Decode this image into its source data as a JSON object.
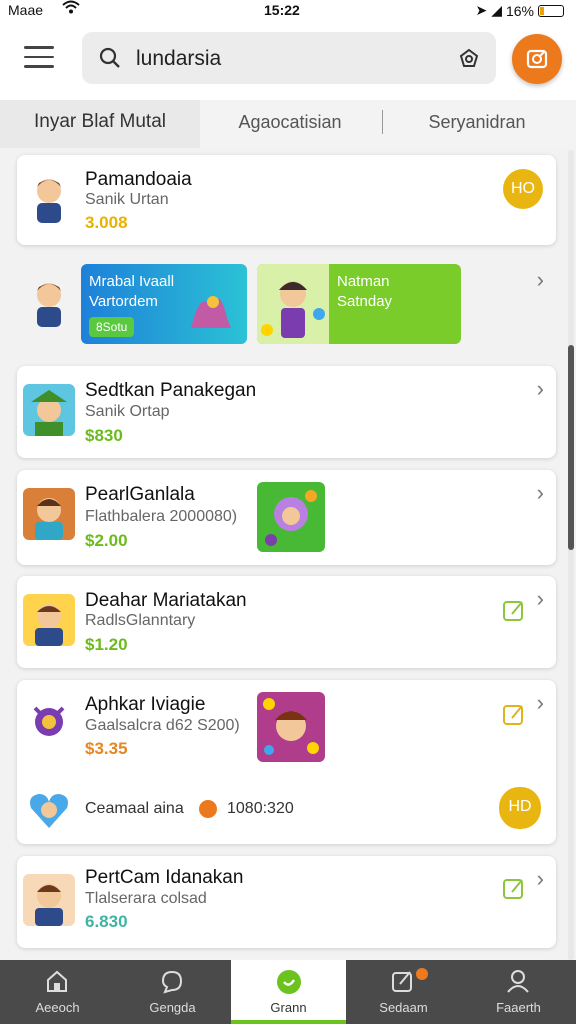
{
  "status": {
    "carrier": "Maae",
    "time": "15:22",
    "battery": "16%",
    "battery_level": 0.16
  },
  "search": {
    "query": "lundarsia"
  },
  "tabs": [
    {
      "label": "Inyar Blaf Mutal",
      "active": true
    },
    {
      "label": "Agaocatisian",
      "active": false
    },
    {
      "label": "Seryanidran",
      "active": false
    }
  ],
  "cards": {
    "c1": {
      "title": "Pamandoaia",
      "subtitle": "Sanik Urtan",
      "price": "3.008",
      "coin": "HO"
    },
    "banners": {
      "b1": {
        "title": "Mrabal Ivaall",
        "subtitle": "Vartordem",
        "pill": "8Sotu"
      },
      "b2": {
        "title": "Natman",
        "subtitle": "Satnday"
      }
    },
    "c3": {
      "title": "Sedtkan Panakegan",
      "subtitle": "Sanik Ortap",
      "price": "$830"
    },
    "c4": {
      "title": "PearlGanlala",
      "subtitle": "Flathbalera 2000080)",
      "price": "$2.00"
    },
    "c5": {
      "title": "Deahar Mariatakan",
      "subtitle": "RadlsGlanntary",
      "price": "$1.20"
    },
    "c6": {
      "title": "Aphkar Iviagie",
      "subtitle": "Gaalsalcra d62 S200)",
      "price": "$3.35",
      "footer_text": "Ceamaal aina",
      "footer_value": "1080:320",
      "coin": "HD"
    },
    "c7": {
      "title": "PertCam Idanakan",
      "subtitle": "Tlalserara colsad",
      "price": "6.830"
    }
  },
  "nav": [
    {
      "label": "Aeeoch",
      "icon": "home-icon",
      "active": false
    },
    {
      "label": "Gengda",
      "icon": "chat-icon",
      "active": false
    },
    {
      "label": "Grann",
      "icon": "circle-icon",
      "active": true
    },
    {
      "label": "Sedaam",
      "icon": "notes-icon",
      "active": false
    },
    {
      "label": "Faaerth",
      "icon": "profile-icon",
      "active": false
    }
  ],
  "colors": {
    "accent": "#ec7a1c",
    "green": "#6cbb1d",
    "coin": "#e9b611"
  }
}
